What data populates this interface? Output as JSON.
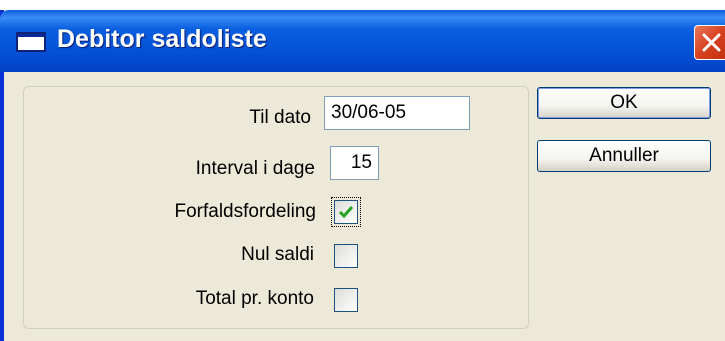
{
  "window": {
    "title": "Debitor saldoliste",
    "close_icon": "close-icon"
  },
  "form": {
    "til_dato_label": "Til dato",
    "til_dato_value": "30/06-05",
    "interval_label": "Interval i dage",
    "interval_value": "15",
    "forfald_label": "Forfaldsfordeling",
    "forfald_checked": true,
    "nul_saldi_label": "Nul saldi",
    "nul_saldi_checked": false,
    "total_label": "Total pr. konto",
    "total_checked": false
  },
  "buttons": {
    "ok_label": "OK",
    "cancel_label": "Annuller"
  },
  "colors": {
    "titlebar": "#0550d6",
    "dialog_bg": "#ece9d8",
    "close_button": "#d6401e",
    "checkmark": "#21a121"
  }
}
